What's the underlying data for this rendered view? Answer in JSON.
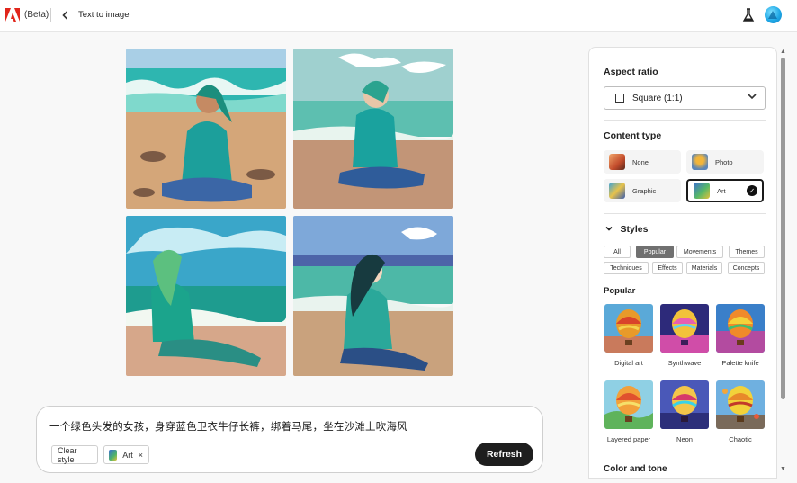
{
  "header": {
    "beta": "(Beta)",
    "title": "Text to image"
  },
  "prompt": {
    "text": "一个绿色头发的女孩，身穿蓝色卫衣牛仔长裤，绑着马尾，坐在沙滩上吹海风",
    "clear_style": "Clear style",
    "style_chip": "Art",
    "remove_chip": "×",
    "refresh": "Refresh"
  },
  "panel": {
    "aspect_ratio_title": "Aspect ratio",
    "aspect_ratio_value": "Square (1:1)",
    "content_type_title": "Content type",
    "content_types": [
      {
        "label": "None"
      },
      {
        "label": "Photo"
      },
      {
        "label": "Graphic"
      },
      {
        "label": "Art",
        "selected": true
      }
    ],
    "styles_title": "Styles",
    "style_tags": [
      "All",
      "Popular",
      "Movements",
      "Themes",
      "Techniques",
      "Effects",
      "Materials",
      "Concepts"
    ],
    "active_tag": "Popular",
    "popular_title": "Popular",
    "popular_styles": [
      "Digital art",
      "Synthwave",
      "Palette knife",
      "Layered paper",
      "Neon",
      "Chaotic"
    ],
    "color_tone_title": "Color and tone"
  },
  "colors": {
    "accent": "#1e1e1e",
    "active_tag": "#707070"
  }
}
